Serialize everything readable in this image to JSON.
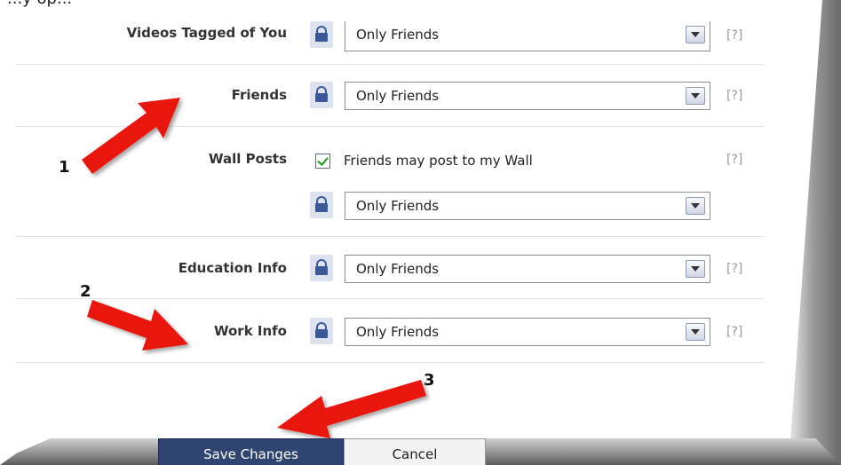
{
  "page": {
    "title_partial": "...y op..."
  },
  "rows": [
    {
      "label": "Videos Tagged of You",
      "select_value": "Only Friends",
      "help": "[?]"
    },
    {
      "label": "Friends",
      "select_value": "Only Friends",
      "help": "[?]"
    },
    {
      "label": "Wall Posts",
      "checkbox_label": "Friends may post to my Wall",
      "checkbox_checked": true,
      "select_value": "Only Friends",
      "help": "[?]"
    },
    {
      "label": "Education Info",
      "select_value": "Only Friends",
      "help": "[?]"
    },
    {
      "label": "Work Info",
      "select_value": "Only Friends",
      "help": "[?]"
    }
  ],
  "annotations": {
    "n1": "1",
    "n2": "2",
    "n3": "3"
  },
  "buttons": {
    "save": "Save Changes",
    "cancel": "Cancel"
  },
  "colors": {
    "arrow": "#e8150f",
    "lock": "#3b5998",
    "save_bg": "#2f4470"
  },
  "icons": [
    "lock-icon",
    "dropdown-arrow-icon",
    "checkbox-checked-icon",
    "red-arrow-annotation"
  ]
}
